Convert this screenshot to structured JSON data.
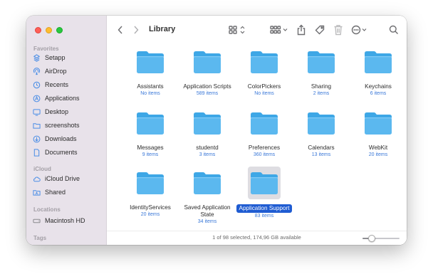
{
  "window": {
    "title": "Library"
  },
  "sidebar": {
    "favorites_label": "Favorites",
    "favorites": [
      {
        "label": "Setapp",
        "icon": "setapp-icon"
      },
      {
        "label": "AirDrop",
        "icon": "airdrop-icon"
      },
      {
        "label": "Recents",
        "icon": "clock-icon"
      },
      {
        "label": "Applications",
        "icon": "applications-icon"
      },
      {
        "label": "Desktop",
        "icon": "desktop-icon"
      },
      {
        "label": "screenshots",
        "icon": "folder-icon"
      },
      {
        "label": "Downloads",
        "icon": "downloads-icon"
      },
      {
        "label": "Documents",
        "icon": "document-icon"
      }
    ],
    "icloud_label": "iCloud",
    "icloud": [
      {
        "label": "iCloud Drive",
        "icon": "cloud-icon"
      },
      {
        "label": "Shared",
        "icon": "shared-folder-icon"
      }
    ],
    "locations_label": "Locations",
    "locations": [
      {
        "label": "Macintosh HD",
        "icon": "disk-icon"
      }
    ],
    "tags_label": "Tags"
  },
  "items": [
    {
      "name": "Assistants",
      "count": "No items"
    },
    {
      "name": "Application Scripts",
      "count": "589 items"
    },
    {
      "name": "ColorPickers",
      "count": "No items"
    },
    {
      "name": "Sharing",
      "count": "2 items"
    },
    {
      "name": "Keychains",
      "count": "6 items"
    },
    {
      "name": "Messages",
      "count": "9 items"
    },
    {
      "name": "studentd",
      "count": "3 items"
    },
    {
      "name": "Preferences",
      "count": "360 items"
    },
    {
      "name": "Calendars",
      "count": "13 items"
    },
    {
      "name": "WebKit",
      "count": "20 items"
    },
    {
      "name": "IdentityServices",
      "count": "20 items"
    },
    {
      "name": "Saved Application State",
      "count": "34 items"
    },
    {
      "name": "Application Support",
      "count": "83 items",
      "selected": true
    }
  ],
  "status": {
    "text": "1 of 98 selected, 174,96 GB available",
    "icon_size_level": 0.25
  },
  "colors": {
    "folder": "#5bb8ef",
    "folder_tab": "#3ea7e6",
    "selection": "#1f5cd2",
    "count_text": "#3a78d8",
    "sidebar_icon": "#4b8ee6"
  }
}
